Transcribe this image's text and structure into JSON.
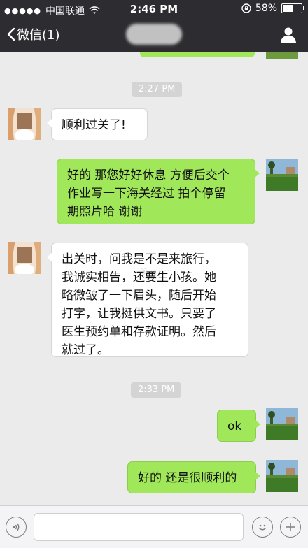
{
  "status_bar": {
    "carrier": "中国联通",
    "time": "2:46 PM",
    "battery": "58%",
    "battery_level": 0.58
  },
  "nav": {
    "back_label": "微信(1)"
  },
  "messages": [
    {
      "type": "timestamp",
      "text": "2:27 PM"
    },
    {
      "type": "in",
      "text": "顺利过关了!"
    },
    {
      "type": "out",
      "lines": [
        "好的 那您好好休息 方便后交个",
        "作业写一下海关经过  拍个停留",
        "期照片哈 谢谢"
      ]
    },
    {
      "type": "in",
      "lines": [
        "出关时，问我是不是来旅行，",
        "我诚实相告，还要生小孩。她",
        "略微皱了一下眉头，随后开始",
        "打字，让我挺供文书。只要了",
        "医生预约单和存款证明。然后",
        "就过了。"
      ]
    },
    {
      "type": "timestamp",
      "text": "2:33 PM"
    },
    {
      "type": "out",
      "text": "ok"
    },
    {
      "type": "out",
      "text": "好的 还是很顺利的"
    }
  ],
  "icons": {
    "back": "chevron-left-icon",
    "profile": "person-icon",
    "voice": "voice-icon",
    "emoji": "emoji-icon",
    "more": "plus-icon",
    "signal": "signal-dots-icon",
    "wifi": "wifi-icon",
    "lock": "orientation-lock-icon"
  },
  "colors": {
    "header_bg": "#2d2d31",
    "chat_bg": "#ebebeb",
    "outgoing_bubble": "#a0e75a",
    "incoming_bubble": "#ffffff",
    "timestamp_bg": "#d4d4d4"
  }
}
